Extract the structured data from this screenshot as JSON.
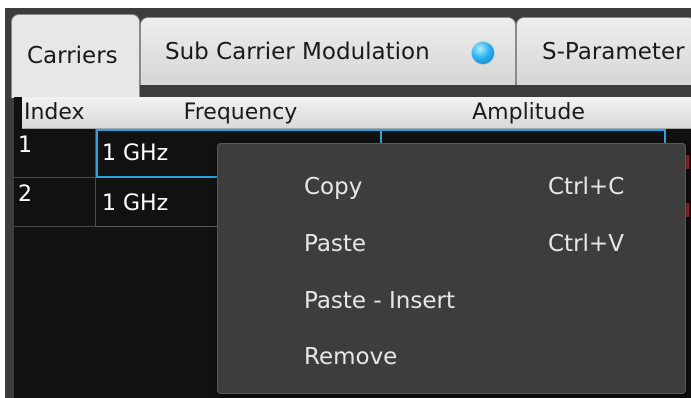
{
  "tabs": [
    {
      "label": "Carriers"
    },
    {
      "label": "Sub Carrier Modulation"
    },
    {
      "label": "S-Parameter"
    }
  ],
  "grid": {
    "columns": [
      "Index",
      "Frequency",
      "Amplitude"
    ],
    "rows": [
      {
        "index": "1",
        "frequency": "1 GHz"
      },
      {
        "index": "2",
        "frequency": "1 GHz"
      }
    ]
  },
  "context_menu": {
    "items": [
      {
        "label": "Copy",
        "shortcut": "Ctrl+C"
      },
      {
        "label": "Paste",
        "shortcut": "Ctrl+V"
      },
      {
        "label": "Paste - Insert",
        "shortcut": ""
      },
      {
        "label": "Remove",
        "shortcut": ""
      }
    ]
  },
  "colors": {
    "accent": "#2aa1e0",
    "background": "#111111",
    "menu_background": "#3d3d3d",
    "status_dot": "#2bb2ee"
  },
  "icons": {
    "status": "status-dot-icon"
  }
}
